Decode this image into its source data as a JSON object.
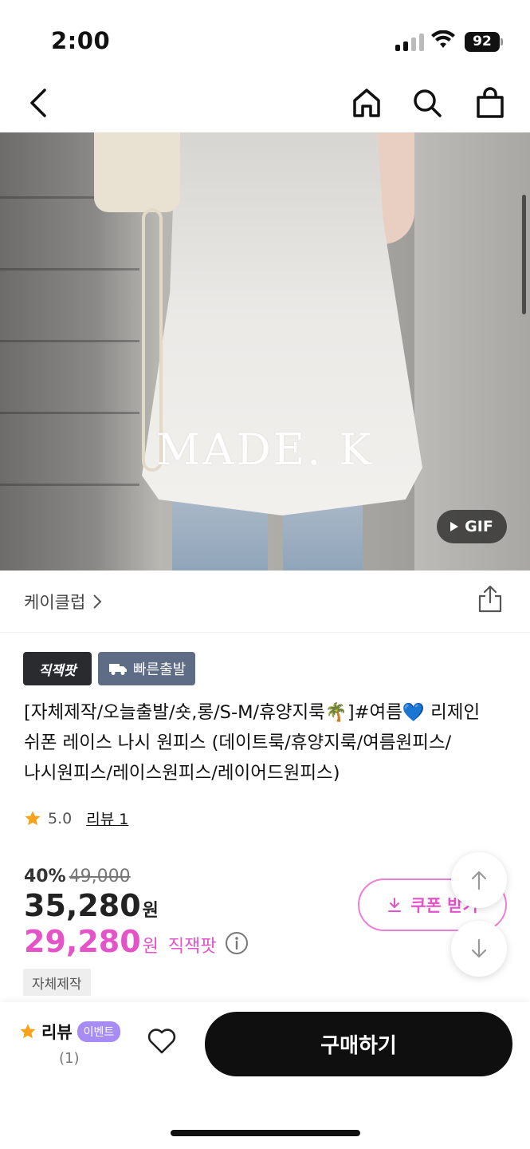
{
  "status": {
    "time": "2:00",
    "battery": "92"
  },
  "hero": {
    "watermark": "MADE. K",
    "gif_label": "GIF"
  },
  "store": {
    "name": "케이클럽"
  },
  "badges": {
    "zikjaekpat": "직잭팟",
    "fast_shipping": "빠른출발"
  },
  "product": {
    "title": "[자체제작/오늘출발/숏,롱/S-M/휴양지룩🌴]#여름💙 리제인 쉬폰 레이스 나시 원피스 (데이트룩/휴양지룩/여름원피스/나시원피스/레이스원피스/레이어드원피스)",
    "rating": "5.0",
    "reviews": "리뷰 1",
    "discount_pct": "40%",
    "original_price": "49,000",
    "price": "35,280",
    "price_unit": "원",
    "special_price": "29,280",
    "special_label": "직잭팟",
    "tag": "자체제작"
  },
  "coupon": {
    "label": "쿠폰 받기"
  },
  "bottom": {
    "review_label": "리뷰",
    "event_badge": "이벤트",
    "review_count": "(1)",
    "buy_label": "구매하기"
  }
}
